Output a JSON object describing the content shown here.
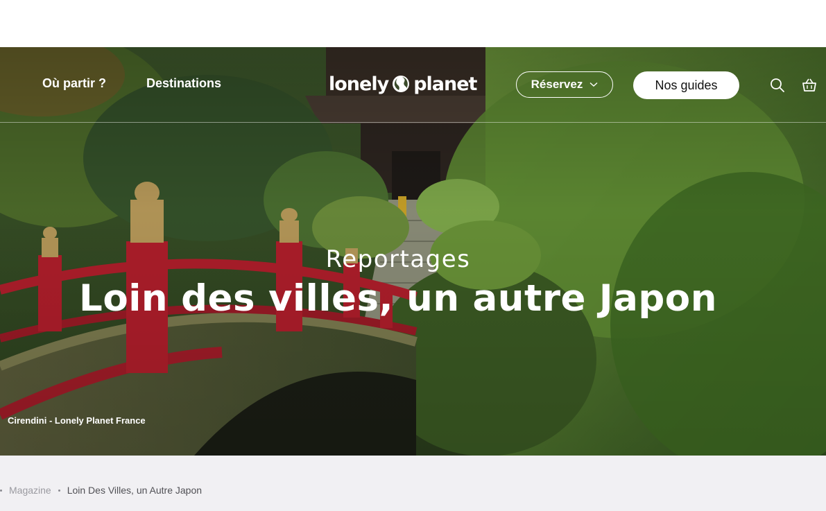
{
  "nav": {
    "items": [
      {
        "label": "Où partir ?"
      },
      {
        "label": "Destinations"
      }
    ],
    "logo": {
      "left": "lonely",
      "right": "planet"
    },
    "book_button": {
      "label": "Réservez",
      "icon": "chevron-down-icon"
    },
    "guides_button": {
      "label": "Nos guides"
    },
    "search_icon": "search-icon",
    "cart_icon": "basket-icon"
  },
  "hero": {
    "kicker": "Reportages",
    "title": "Loin des villes, un autre Japon",
    "credit": "Cirendini - Lonely Planet France"
  },
  "breadcrumb": {
    "items": [
      {
        "label": "Magazine"
      },
      {
        "label": "Loin Des Villes, un Autre Japon"
      }
    ]
  },
  "colors": {
    "bridge_red": "#b11e2b",
    "foliage": "#4f7a2a",
    "breadcrumb_bg": "#f1f0f3"
  }
}
